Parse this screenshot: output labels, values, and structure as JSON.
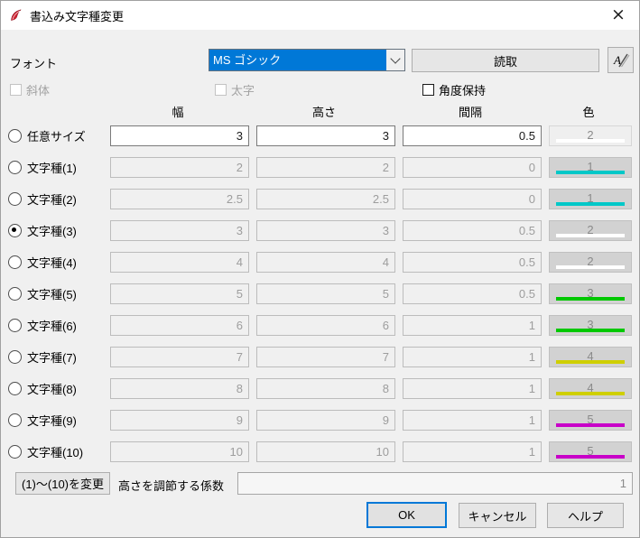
{
  "window": {
    "title": "書込み文字種変更",
    "close_glyph": "×"
  },
  "font_row": {
    "label": "フォント",
    "selected_font": "MS ゴシック",
    "read_button": "読取"
  },
  "checkboxes": {
    "italic": {
      "label": "斜体",
      "checked": false,
      "enabled": false
    },
    "bold": {
      "label": "太字",
      "checked": false,
      "enabled": false
    },
    "keep_angle": {
      "label": "角度保持",
      "checked": false,
      "enabled": true
    }
  },
  "column_headers": {
    "width": "幅",
    "height": "高さ",
    "spacing": "間隔",
    "color": "色"
  },
  "rows": [
    {
      "label": "任意サイズ",
      "selected": false,
      "editable": true,
      "width": "3",
      "height": "3",
      "spacing": "0.5",
      "pen": "2",
      "pen_color": "#ffffff"
    },
    {
      "label": "文字種(1)",
      "selected": false,
      "editable": false,
      "width": "2",
      "height": "2",
      "spacing": "0",
      "pen": "1",
      "pen_color": "#00c8c8"
    },
    {
      "label": "文字種(2)",
      "selected": false,
      "editable": false,
      "width": "2.5",
      "height": "2.5",
      "spacing": "0",
      "pen": "1",
      "pen_color": "#00c8c8"
    },
    {
      "label": "文字種(3)",
      "selected": true,
      "editable": false,
      "width": "3",
      "height": "3",
      "spacing": "0.5",
      "pen": "2",
      "pen_color": "#ffffff"
    },
    {
      "label": "文字種(4)",
      "selected": false,
      "editable": false,
      "width": "4",
      "height": "4",
      "spacing": "0.5",
      "pen": "2",
      "pen_color": "#ffffff"
    },
    {
      "label": "文字種(5)",
      "selected": false,
      "editable": false,
      "width": "5",
      "height": "5",
      "spacing": "0.5",
      "pen": "3",
      "pen_color": "#00c800"
    },
    {
      "label": "文字種(6)",
      "selected": false,
      "editable": false,
      "width": "6",
      "height": "6",
      "spacing": "1",
      "pen": "3",
      "pen_color": "#00c800"
    },
    {
      "label": "文字種(7)",
      "selected": false,
      "editable": false,
      "width": "7",
      "height": "7",
      "spacing": "1",
      "pen": "4",
      "pen_color": "#cfcf00"
    },
    {
      "label": "文字種(8)",
      "selected": false,
      "editable": false,
      "width": "8",
      "height": "8",
      "spacing": "1",
      "pen": "4",
      "pen_color": "#cfcf00"
    },
    {
      "label": "文字種(9)",
      "selected": false,
      "editable": false,
      "width": "9",
      "height": "9",
      "spacing": "1",
      "pen": "5",
      "pen_color": "#c800c8"
    },
    {
      "label": "文字種(10)",
      "selected": false,
      "editable": false,
      "width": "10",
      "height": "10",
      "spacing": "1",
      "pen": "5",
      "pen_color": "#c800c8"
    }
  ],
  "footer": {
    "change_button": "(1)～(10)を変更",
    "factor_label": "高さを調節する係数",
    "factor_value": "1",
    "ok_button": "OK",
    "cancel_button": "キャンセル",
    "help_button": "ヘルプ"
  },
  "colors": {
    "accent": "#0078d7",
    "titlebar_bg": "#ffffff",
    "dialog_bg": "#f0f0f0",
    "pen_colors": {
      "1": "#00c8c8",
      "2": "#ffffff",
      "3": "#00c800",
      "4": "#cfcf00",
      "5": "#c800c8"
    }
  }
}
